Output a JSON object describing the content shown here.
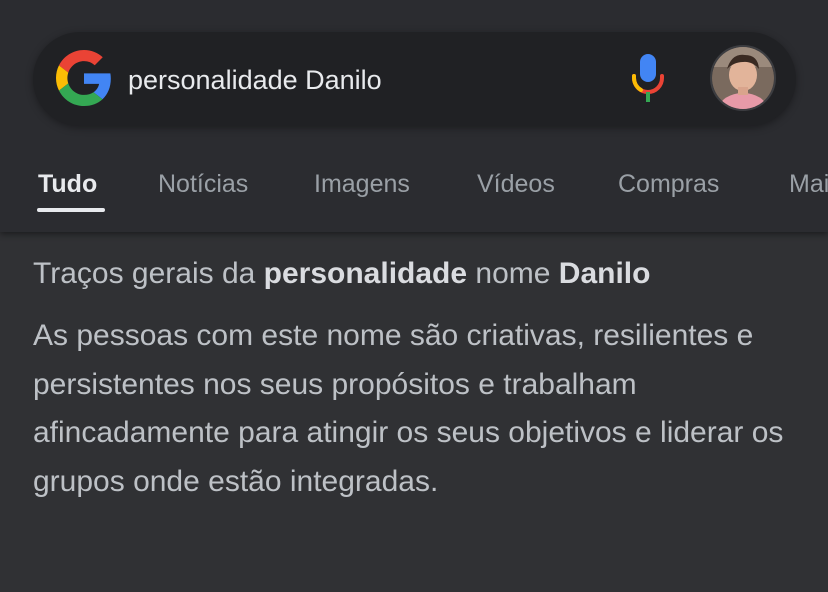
{
  "search": {
    "query": "personalidade Danilo"
  },
  "icons": {
    "logo": "google-g-icon",
    "mic": "microphone-icon",
    "avatar": "user-avatar"
  },
  "colors": {
    "background": "#303134",
    "google_blue": "#4285F4",
    "google_red": "#EA4335",
    "google_yellow": "#FBBC05",
    "google_green": "#34A853"
  },
  "tabs": [
    {
      "label": "Tudo",
      "active": true
    },
    {
      "label": "Notícias",
      "active": false
    },
    {
      "label": "Imagens",
      "active": false
    },
    {
      "label": "Vídeos",
      "active": false
    },
    {
      "label": "Compras",
      "active": false
    },
    {
      "label": "Mais",
      "active": false
    }
  ],
  "result": {
    "heading_part1": "Traços gerais da ",
    "heading_bold1": "personalidade",
    "heading_part2": " nome ",
    "heading_bold2": "Danilo",
    "body": "As pessoas com este nome são criativas, resilientes e persistentes nos seus propósitos e trabalham afincadamente para atingir os seus objetivos e liderar os grupos onde estão integradas."
  }
}
